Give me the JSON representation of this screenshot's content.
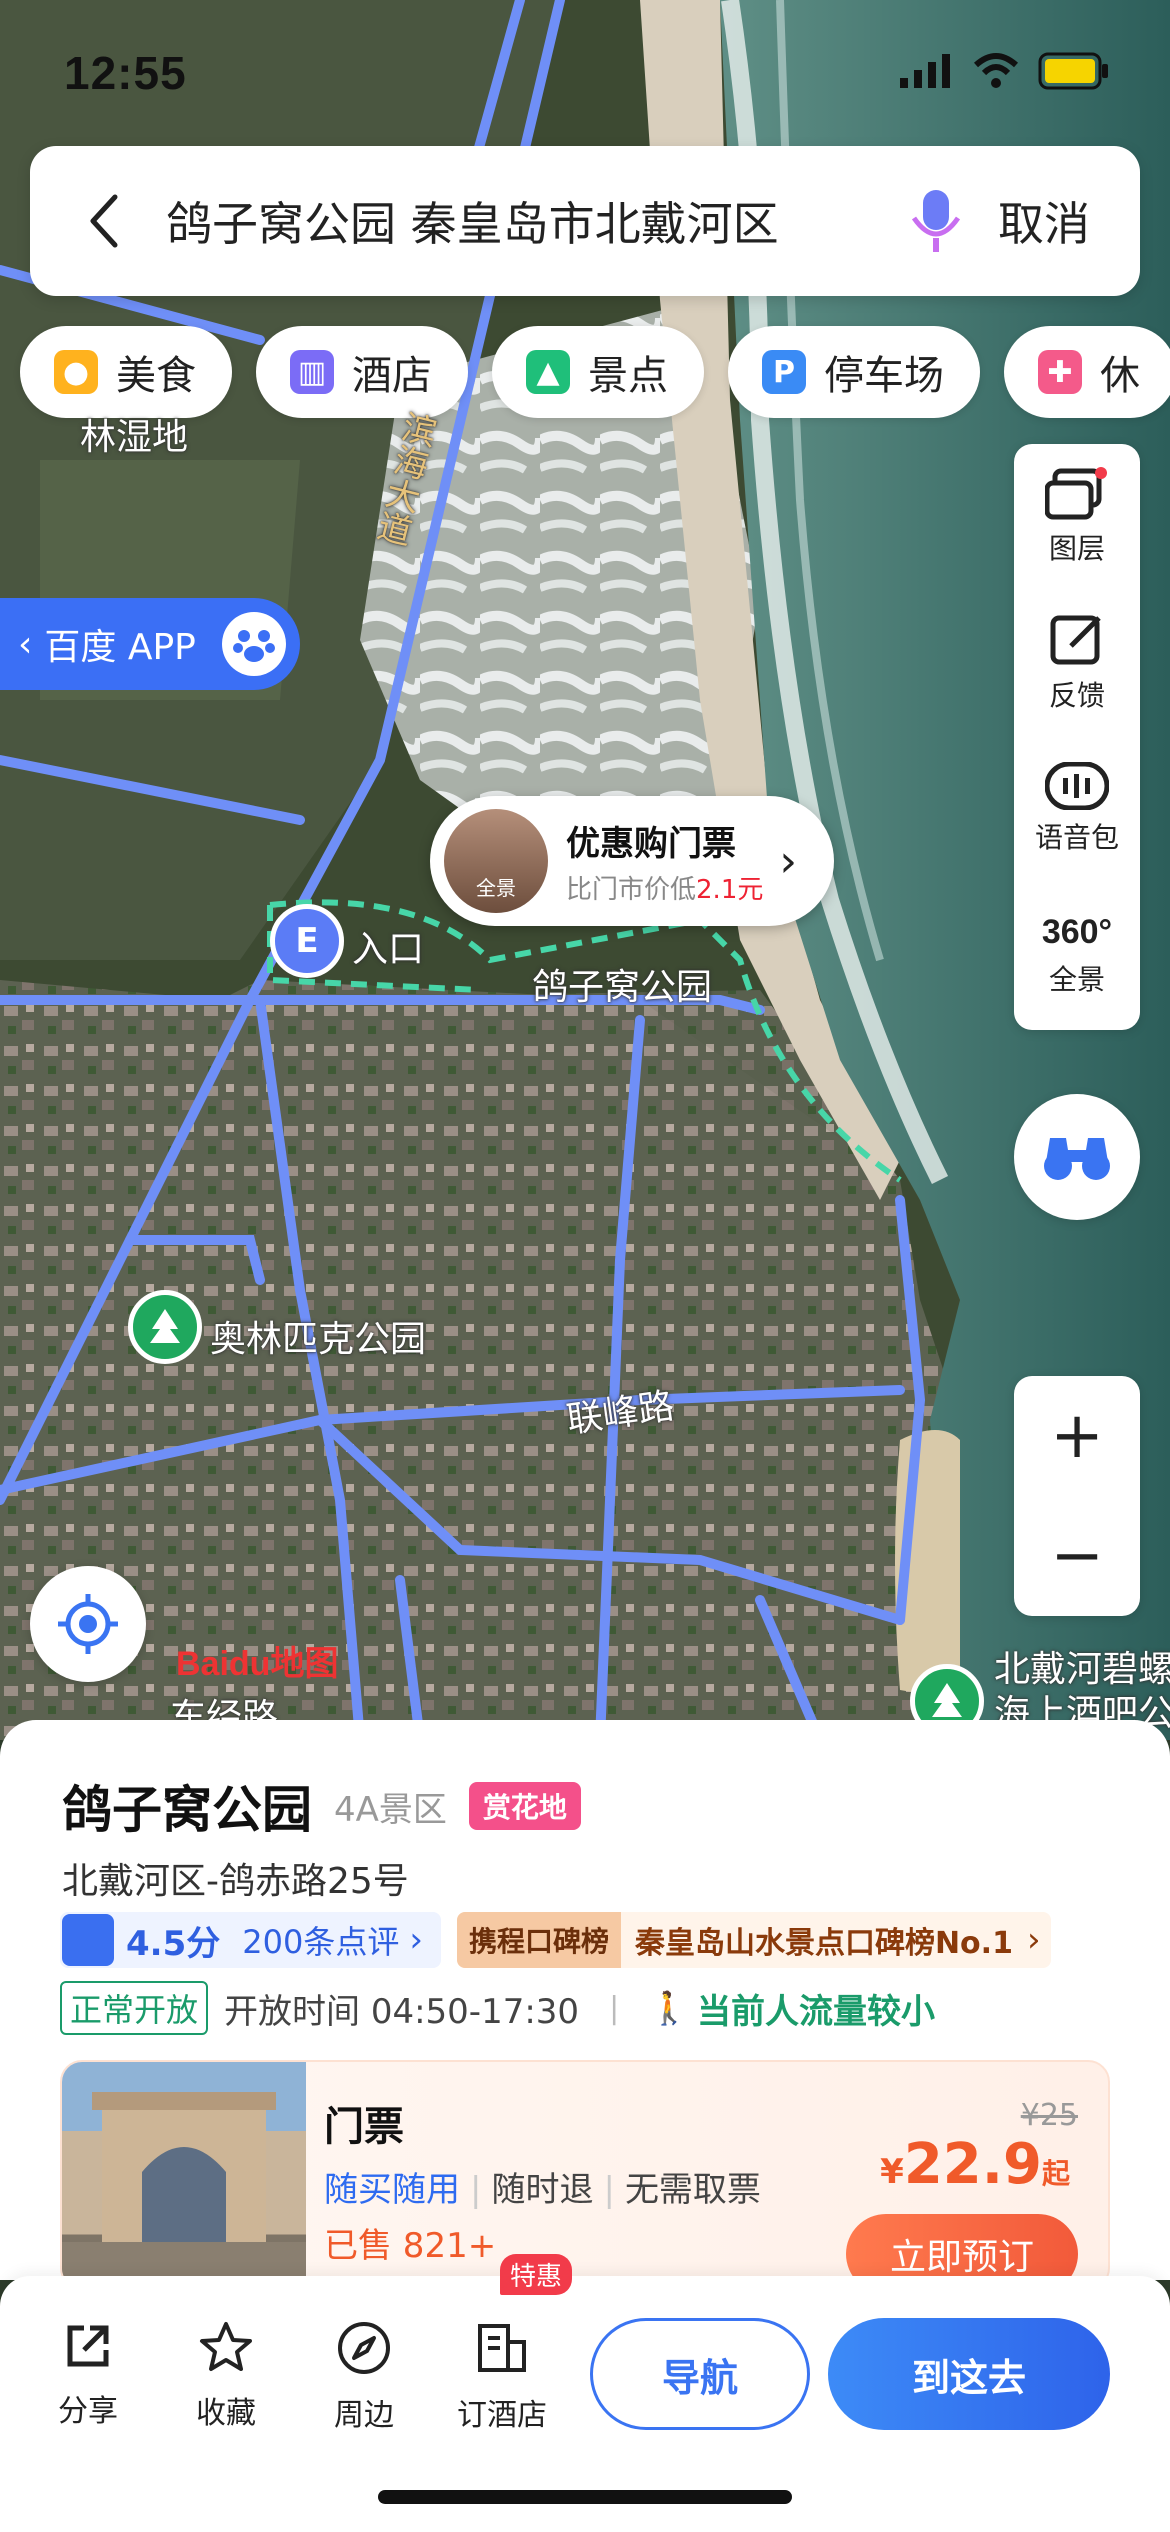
{
  "status": {
    "time": "12:55"
  },
  "search": {
    "query": "鸽子窝公园 秦皇岛市北戴河区",
    "cancel": "取消"
  },
  "chips": [
    "美食",
    "酒店",
    "景点",
    "停车场",
    "休"
  ],
  "baidu_app": {
    "label": "百度 APP"
  },
  "tools": {
    "layers": "图层",
    "feedback": "反馈",
    "voice_pack": "语音包",
    "panorama": "全景",
    "panorama_badge": "360°"
  },
  "map_labels": {
    "road_binhai": "滨海大道",
    "entrance": "入口",
    "park": "鸽子窝公园",
    "olympic": "奥林匹克公园",
    "lianfeng": "联峰路",
    "forest": "林湿地",
    "beidaihe": "北戴河碧螺塔",
    "beidaihe2": "海上酒吧公",
    "dongjing": "东经路",
    "baidu_logo": "Baidu地图"
  },
  "ticket_bubble": {
    "title": "优惠购门票",
    "subtitle_prefix": "比门市价低",
    "subtitle_value": "2.1元",
    "thumb_label": "全景"
  },
  "poi": {
    "name": "鸽子窝公园",
    "level": "4A景区",
    "tag": "赏花地",
    "address": "北戴河区-鸽赤路25号",
    "score": "4.5分",
    "reviews": "200条点评",
    "ctrip_badge": "携程口碑榜",
    "ctrip_text": "秦皇岛山水景点口碑榜No.1",
    "open_status": "正常开放",
    "hours": "开放时间 04:50-17:30",
    "crowd": "当前人流量较小"
  },
  "ticket": {
    "name": "门票",
    "feature1": "随买随用",
    "feature2": "随时退",
    "feature3": "无需取票",
    "sold": "已售 821+",
    "orig_price": "¥25",
    "currency": "¥",
    "price": "22.9",
    "price_suffix": "起",
    "book": "立即预订"
  },
  "bottom": {
    "share": "分享",
    "favorite": "收藏",
    "nearby": "周边",
    "hotel": "订酒店",
    "hot_badge": "特惠",
    "navigate": "导航",
    "go": "到这去"
  }
}
